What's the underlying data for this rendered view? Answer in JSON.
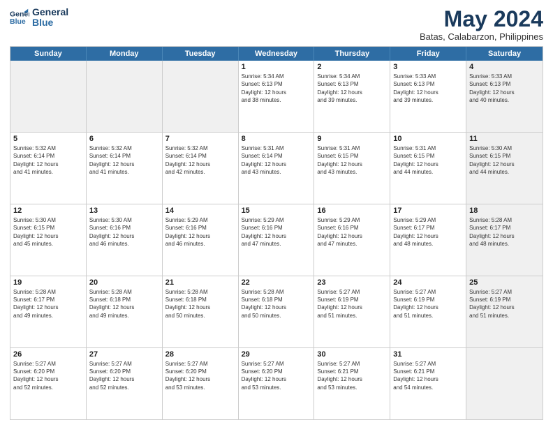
{
  "logo": {
    "line1": "General",
    "line2": "Blue"
  },
  "title": "May 2024",
  "subtitle": "Batas, Calabarzon, Philippines",
  "header_days": [
    "Sunday",
    "Monday",
    "Tuesday",
    "Wednesday",
    "Thursday",
    "Friday",
    "Saturday"
  ],
  "weeks": [
    [
      {
        "day": "",
        "text": "",
        "shaded": true
      },
      {
        "day": "",
        "text": "",
        "shaded": true
      },
      {
        "day": "",
        "text": "",
        "shaded": true
      },
      {
        "day": "1",
        "text": "Sunrise: 5:34 AM\nSunset: 6:13 PM\nDaylight: 12 hours\nand 38 minutes.",
        "shaded": false
      },
      {
        "day": "2",
        "text": "Sunrise: 5:34 AM\nSunset: 6:13 PM\nDaylight: 12 hours\nand 39 minutes.",
        "shaded": false
      },
      {
        "day": "3",
        "text": "Sunrise: 5:33 AM\nSunset: 6:13 PM\nDaylight: 12 hours\nand 39 minutes.",
        "shaded": false
      },
      {
        "day": "4",
        "text": "Sunrise: 5:33 AM\nSunset: 6:13 PM\nDaylight: 12 hours\nand 40 minutes.",
        "shaded": true
      }
    ],
    [
      {
        "day": "5",
        "text": "Sunrise: 5:32 AM\nSunset: 6:14 PM\nDaylight: 12 hours\nand 41 minutes.",
        "shaded": false
      },
      {
        "day": "6",
        "text": "Sunrise: 5:32 AM\nSunset: 6:14 PM\nDaylight: 12 hours\nand 41 minutes.",
        "shaded": false
      },
      {
        "day": "7",
        "text": "Sunrise: 5:32 AM\nSunset: 6:14 PM\nDaylight: 12 hours\nand 42 minutes.",
        "shaded": false
      },
      {
        "day": "8",
        "text": "Sunrise: 5:31 AM\nSunset: 6:14 PM\nDaylight: 12 hours\nand 43 minutes.",
        "shaded": false
      },
      {
        "day": "9",
        "text": "Sunrise: 5:31 AM\nSunset: 6:15 PM\nDaylight: 12 hours\nand 43 minutes.",
        "shaded": false
      },
      {
        "day": "10",
        "text": "Sunrise: 5:31 AM\nSunset: 6:15 PM\nDaylight: 12 hours\nand 44 minutes.",
        "shaded": false
      },
      {
        "day": "11",
        "text": "Sunrise: 5:30 AM\nSunset: 6:15 PM\nDaylight: 12 hours\nand 44 minutes.",
        "shaded": true
      }
    ],
    [
      {
        "day": "12",
        "text": "Sunrise: 5:30 AM\nSunset: 6:15 PM\nDaylight: 12 hours\nand 45 minutes.",
        "shaded": false
      },
      {
        "day": "13",
        "text": "Sunrise: 5:30 AM\nSunset: 6:16 PM\nDaylight: 12 hours\nand 46 minutes.",
        "shaded": false
      },
      {
        "day": "14",
        "text": "Sunrise: 5:29 AM\nSunset: 6:16 PM\nDaylight: 12 hours\nand 46 minutes.",
        "shaded": false
      },
      {
        "day": "15",
        "text": "Sunrise: 5:29 AM\nSunset: 6:16 PM\nDaylight: 12 hours\nand 47 minutes.",
        "shaded": false
      },
      {
        "day": "16",
        "text": "Sunrise: 5:29 AM\nSunset: 6:16 PM\nDaylight: 12 hours\nand 47 minutes.",
        "shaded": false
      },
      {
        "day": "17",
        "text": "Sunrise: 5:29 AM\nSunset: 6:17 PM\nDaylight: 12 hours\nand 48 minutes.",
        "shaded": false
      },
      {
        "day": "18",
        "text": "Sunrise: 5:28 AM\nSunset: 6:17 PM\nDaylight: 12 hours\nand 48 minutes.",
        "shaded": true
      }
    ],
    [
      {
        "day": "19",
        "text": "Sunrise: 5:28 AM\nSunset: 6:17 PM\nDaylight: 12 hours\nand 49 minutes.",
        "shaded": false
      },
      {
        "day": "20",
        "text": "Sunrise: 5:28 AM\nSunset: 6:18 PM\nDaylight: 12 hours\nand 49 minutes.",
        "shaded": false
      },
      {
        "day": "21",
        "text": "Sunrise: 5:28 AM\nSunset: 6:18 PM\nDaylight: 12 hours\nand 50 minutes.",
        "shaded": false
      },
      {
        "day": "22",
        "text": "Sunrise: 5:28 AM\nSunset: 6:18 PM\nDaylight: 12 hours\nand 50 minutes.",
        "shaded": false
      },
      {
        "day": "23",
        "text": "Sunrise: 5:27 AM\nSunset: 6:19 PM\nDaylight: 12 hours\nand 51 minutes.",
        "shaded": false
      },
      {
        "day": "24",
        "text": "Sunrise: 5:27 AM\nSunset: 6:19 PM\nDaylight: 12 hours\nand 51 minutes.",
        "shaded": false
      },
      {
        "day": "25",
        "text": "Sunrise: 5:27 AM\nSunset: 6:19 PM\nDaylight: 12 hours\nand 51 minutes.",
        "shaded": true
      }
    ],
    [
      {
        "day": "26",
        "text": "Sunrise: 5:27 AM\nSunset: 6:20 PM\nDaylight: 12 hours\nand 52 minutes.",
        "shaded": false
      },
      {
        "day": "27",
        "text": "Sunrise: 5:27 AM\nSunset: 6:20 PM\nDaylight: 12 hours\nand 52 minutes.",
        "shaded": false
      },
      {
        "day": "28",
        "text": "Sunrise: 5:27 AM\nSunset: 6:20 PM\nDaylight: 12 hours\nand 53 minutes.",
        "shaded": false
      },
      {
        "day": "29",
        "text": "Sunrise: 5:27 AM\nSunset: 6:20 PM\nDaylight: 12 hours\nand 53 minutes.",
        "shaded": false
      },
      {
        "day": "30",
        "text": "Sunrise: 5:27 AM\nSunset: 6:21 PM\nDaylight: 12 hours\nand 53 minutes.",
        "shaded": false
      },
      {
        "day": "31",
        "text": "Sunrise: 5:27 AM\nSunset: 6:21 PM\nDaylight: 12 hours\nand 54 minutes.",
        "shaded": false
      },
      {
        "day": "",
        "text": "",
        "shaded": true
      }
    ]
  ]
}
